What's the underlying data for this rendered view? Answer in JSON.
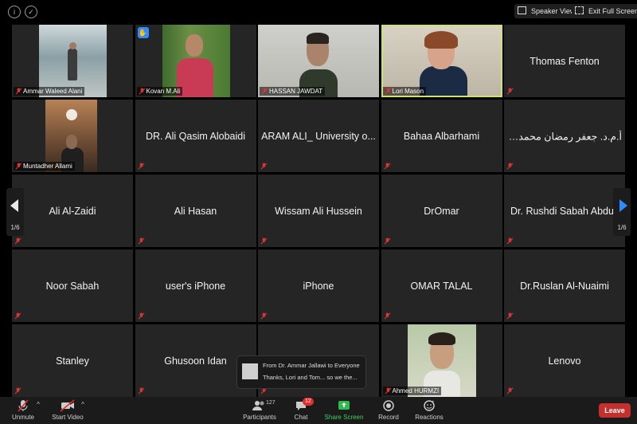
{
  "topbar": {
    "info_icon": "info-icon",
    "security_icon": "shield-check-icon",
    "speaker_view_label": "Speaker View",
    "exit_fullscreen_label": "Exit Full Screen"
  },
  "tiles": [
    {
      "name": "Ammar Waleed Alani",
      "video": true,
      "hand_raised": false,
      "active": false
    },
    {
      "name": "Kovan M.Ali",
      "video": true,
      "hand_raised": true,
      "active": false
    },
    {
      "name": "HASSAN JAWDAT",
      "video": true,
      "hand_raised": false,
      "active": false
    },
    {
      "name": "Lori Mason",
      "video": true,
      "hand_raised": false,
      "active": true
    },
    {
      "name": "Thomas Fenton",
      "video": false
    },
    {
      "name": "Muntadher Allami",
      "video": true,
      "hand_raised": false,
      "active": false
    },
    {
      "name": "DR. Ali Qasim Alobaidi",
      "video": false
    },
    {
      "name": "ARAM ALI_ University o...",
      "video": false
    },
    {
      "name": "Bahaa Albarhami",
      "video": false
    },
    {
      "name": "أ.م.د. جعفر رمضان محمد /...",
      "video": false
    },
    {
      "name": "Ali Al-Zaidi",
      "video": false
    },
    {
      "name": "Ali Hasan",
      "video": false
    },
    {
      "name": "Wissam Ali Hussein",
      "video": false
    },
    {
      "name": "DrOmar",
      "video": false
    },
    {
      "name": "Dr. Rushdi Sabah Abdul",
      "video": false
    },
    {
      "name": "Noor Sabah",
      "video": false
    },
    {
      "name": "user's iPhone",
      "video": false
    },
    {
      "name": "iPhone",
      "video": false
    },
    {
      "name": "OMAR TALAL",
      "video": false
    },
    {
      "name": "Dr.Ruslan Al-Nuaimi",
      "video": false
    },
    {
      "name": "Stanley",
      "video": false
    },
    {
      "name": "Ghusoon Idan",
      "video": false
    },
    {
      "name": "",
      "video": false
    },
    {
      "name": "Ahmed HURMZI",
      "video": true,
      "hand_raised": false,
      "active": false
    },
    {
      "name": "Lenovo",
      "video": false
    }
  ],
  "pagination": {
    "left": "1/6",
    "right": "1/6"
  },
  "chat_popup": {
    "from": "From Dr. Ammar Jallawi to Everyone",
    "message": "Thanks, Lori and Tom... so we the..."
  },
  "bottombar": {
    "unmute_label": "Unmute",
    "start_video_label": "Start Video",
    "participants_label": "Participants",
    "participants_count": "127",
    "chat_label": "Chat",
    "chat_badge": "12",
    "share_label": "Share Screen",
    "record_label": "Record",
    "reactions_label": "Reactions",
    "leave_label": "Leave"
  },
  "colors": {
    "active_speaker": "#cfe36b",
    "share_green": "#2dbd4e",
    "leave_red": "#c4302b",
    "badge_red": "#e02d2d",
    "hand_blue": "#2d8cff"
  }
}
